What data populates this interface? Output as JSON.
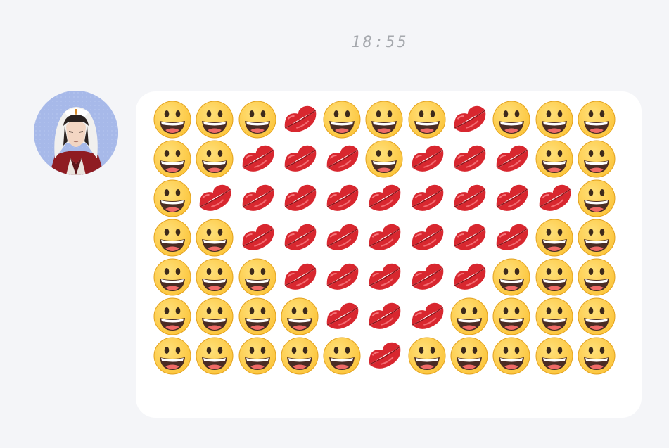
{
  "conversation": {
    "timestamp": "18:55"
  },
  "message": {
    "emoji_grid": [
      [
        "grinning-face",
        "grinning-face",
        "grinning-face",
        "kiss-mark",
        "grinning-face",
        "grinning-face",
        "grinning-face",
        "kiss-mark",
        "grinning-face",
        "grinning-face",
        "grinning-face"
      ],
      [
        "grinning-face",
        "grinning-face",
        "kiss-mark",
        "kiss-mark",
        "kiss-mark",
        "grinning-face",
        "kiss-mark",
        "kiss-mark",
        "kiss-mark",
        "grinning-face",
        "grinning-face"
      ],
      [
        "grinning-face",
        "kiss-mark",
        "kiss-mark",
        "kiss-mark",
        "kiss-mark",
        "kiss-mark",
        "kiss-mark",
        "kiss-mark",
        "kiss-mark",
        "kiss-mark",
        "grinning-face"
      ],
      [
        "grinning-face",
        "grinning-face",
        "kiss-mark",
        "kiss-mark",
        "kiss-mark",
        "kiss-mark",
        "kiss-mark",
        "kiss-mark",
        "kiss-mark",
        "grinning-face",
        "grinning-face"
      ],
      [
        "grinning-face",
        "grinning-face",
        "grinning-face",
        "kiss-mark",
        "kiss-mark",
        "kiss-mark",
        "kiss-mark",
        "kiss-mark",
        "grinning-face",
        "grinning-face",
        "grinning-face"
      ],
      [
        "grinning-face",
        "grinning-face",
        "grinning-face",
        "grinning-face",
        "kiss-mark",
        "kiss-mark",
        "kiss-mark",
        "grinning-face",
        "grinning-face",
        "grinning-face",
        "grinning-face"
      ],
      [
        "grinning-face",
        "grinning-face",
        "grinning-face",
        "grinning-face",
        "grinning-face",
        "kiss-mark",
        "grinning-face",
        "grinning-face",
        "grinning-face",
        "grinning-face",
        "grinning-face"
      ]
    ]
  },
  "colors": {
    "background": "#f4f5f8",
    "bubble": "#ffffff",
    "timestamp": "#a5a8ad",
    "avatar_bg": "#a7b9e9",
    "face": "#fcc63e",
    "lips": "#d8272f"
  }
}
